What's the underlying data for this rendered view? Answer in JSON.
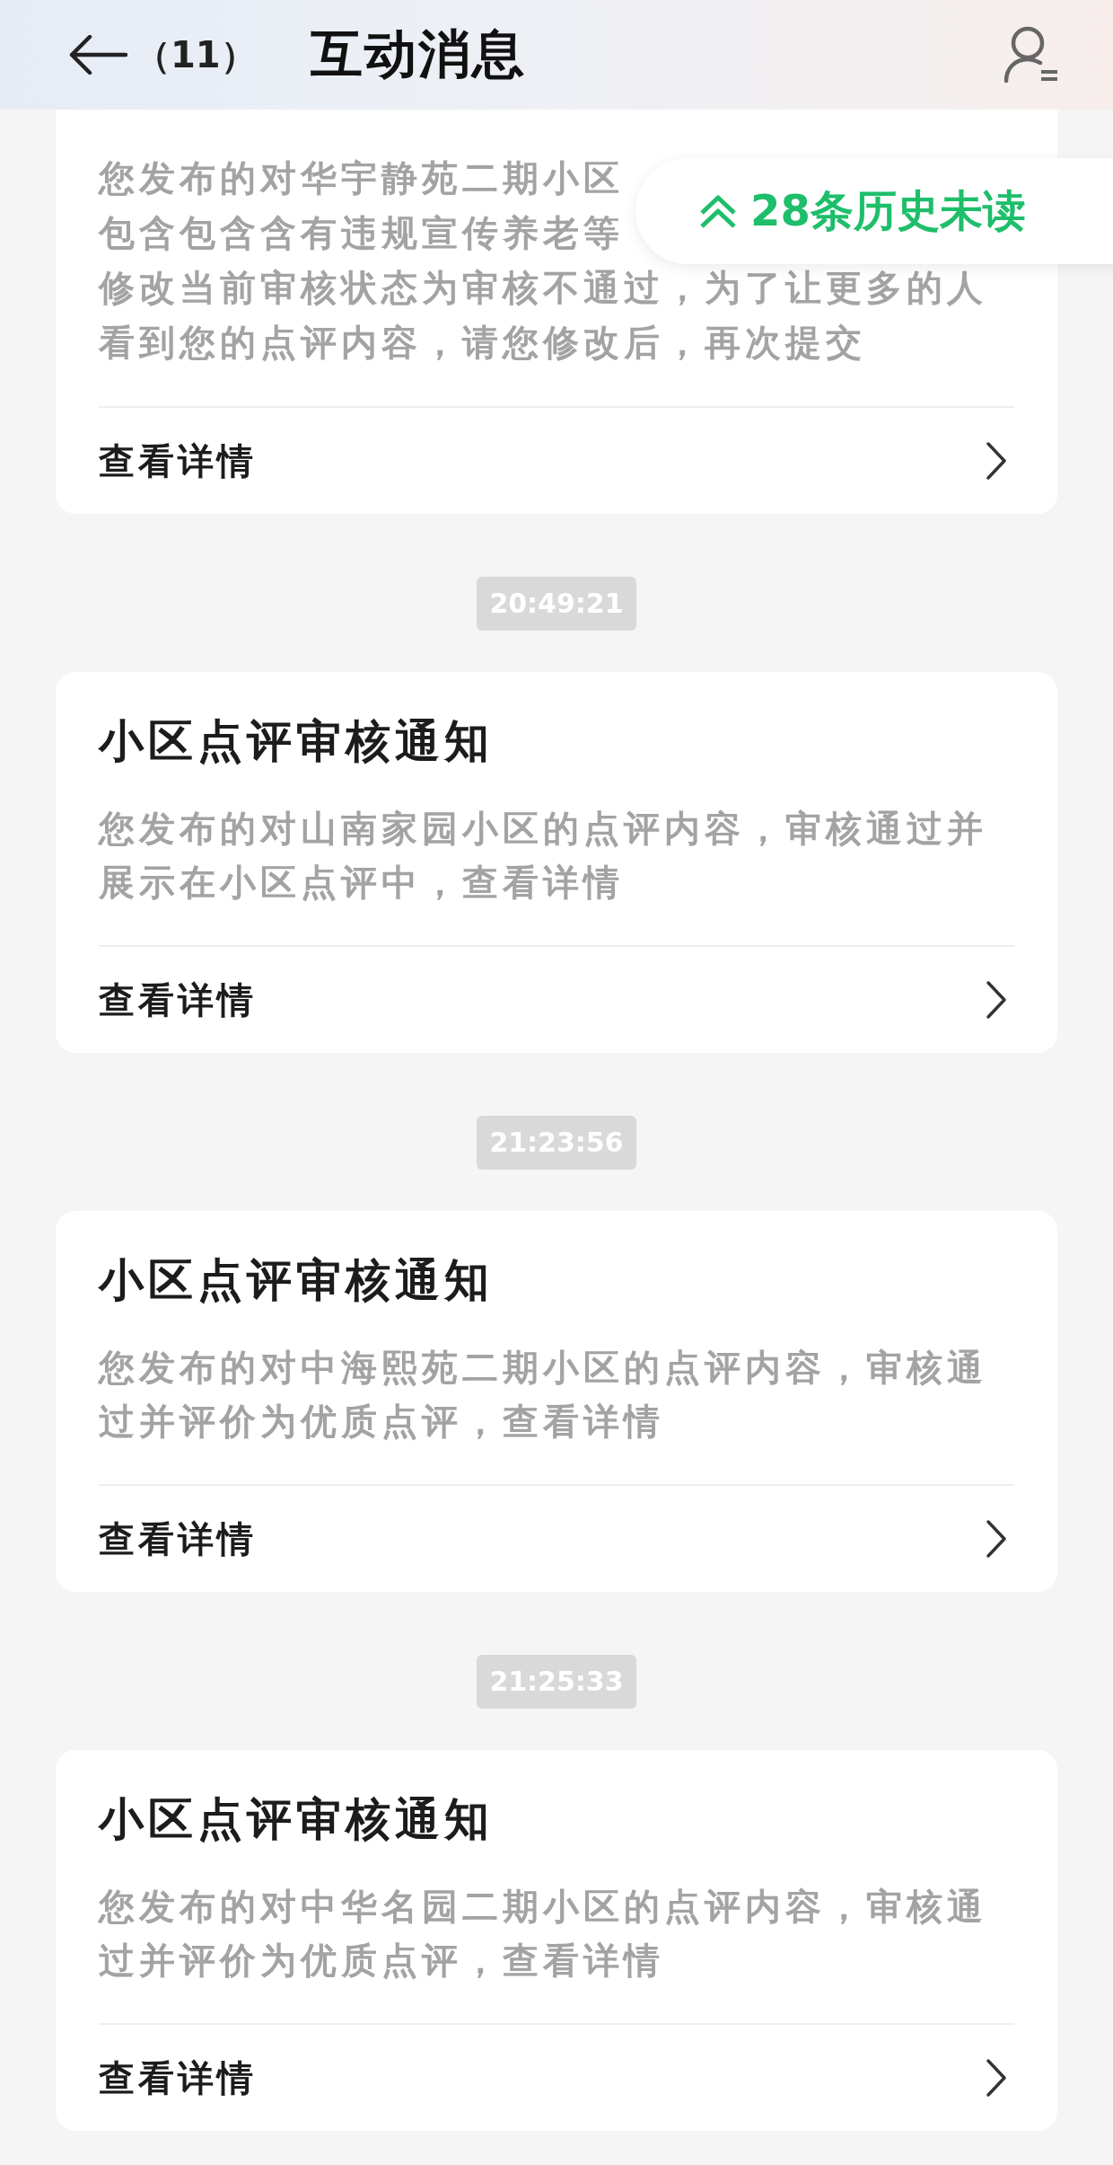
{
  "header": {
    "back_count": "（11）",
    "title": "互动消息"
  },
  "unread_banner": {
    "label": "28条历史未读"
  },
  "messages": [
    {
      "kind": "partial",
      "body_lines": [
        "您发布的对华宇静苑二期小区",
        "包含包含含有违规宣传养老等",
        "修改当前审核状态为审核不通过，为了让更多的人",
        "看到您的点评内容，请您修改后，再次提交"
      ],
      "action": "查看详情"
    },
    {
      "kind": "full",
      "time": "20:49:21",
      "title": "小区点评审核通知",
      "body": "您发布的对山南家园小区的点评内容，审核通过并展示在小区点评中，查看详情",
      "action": "查看详情"
    },
    {
      "kind": "full",
      "time": "21:23:56",
      "title": "小区点评审核通知",
      "body": "您发布的对中海熙苑二期小区的点评内容，审核通过并评价为优质点评，查看详情",
      "action": "查看详情"
    },
    {
      "kind": "full",
      "time": "21:25:33",
      "title": "小区点评审核通知",
      "body": "您发布的对中华名园二期小区的点评内容，审核通过并评价为优质点评，查看详情",
      "action": "查看详情"
    }
  ]
}
